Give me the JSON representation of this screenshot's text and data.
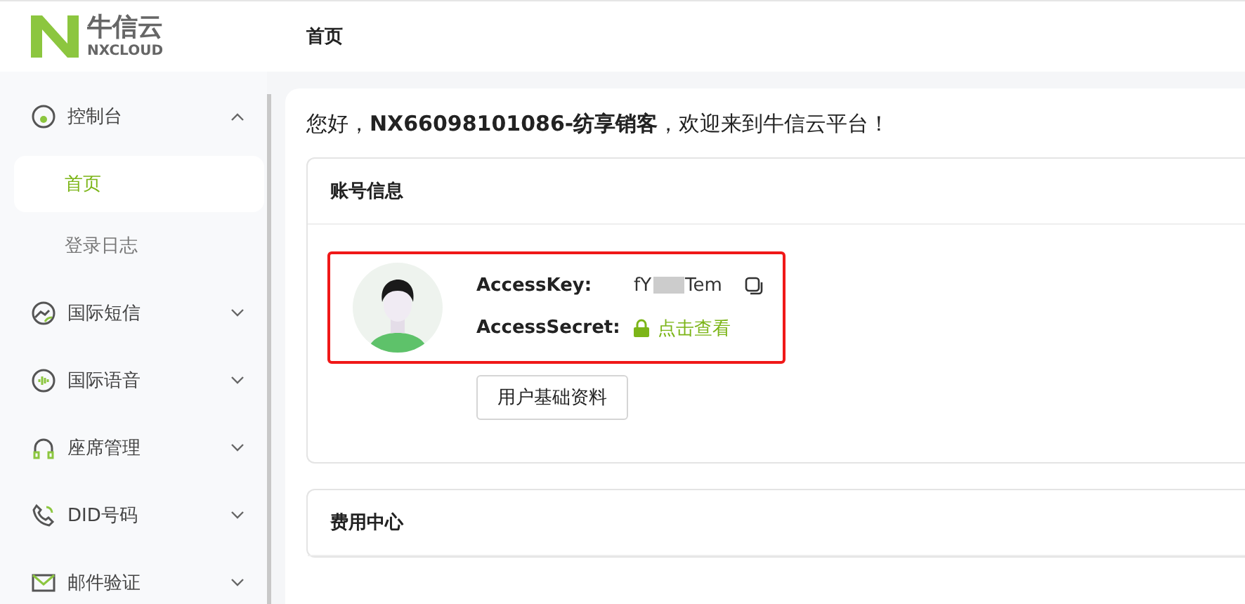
{
  "logo": {
    "name": "牛信云",
    "sub": "NXCLOUD"
  },
  "header": {
    "title": "首页"
  },
  "sidebar": {
    "items": [
      {
        "label": "控制台",
        "expanded": true,
        "children": [
          {
            "label": "首页",
            "selected": true
          },
          {
            "label": "登录日志",
            "selected": false
          }
        ]
      },
      {
        "label": "国际短信",
        "expanded": false
      },
      {
        "label": "国际语音",
        "expanded": false
      },
      {
        "label": "座席管理",
        "expanded": false
      },
      {
        "label": "DID号码",
        "expanded": false
      },
      {
        "label": "邮件验证",
        "expanded": false
      }
    ]
  },
  "greeting": "您好，**NX66098101086-纺享销客**，欢迎来到牛信云平台！",
  "account_card": {
    "title": "账号信息",
    "access_key_label": "AccessKey:",
    "access_key_start": "fY",
    "access_key_end": "Tem",
    "access_secret_label": "AccessSecret:",
    "reveal_link": "点击查看",
    "profile_button": "用户基础资料"
  },
  "cost_card": {
    "title": "费用中心"
  }
}
